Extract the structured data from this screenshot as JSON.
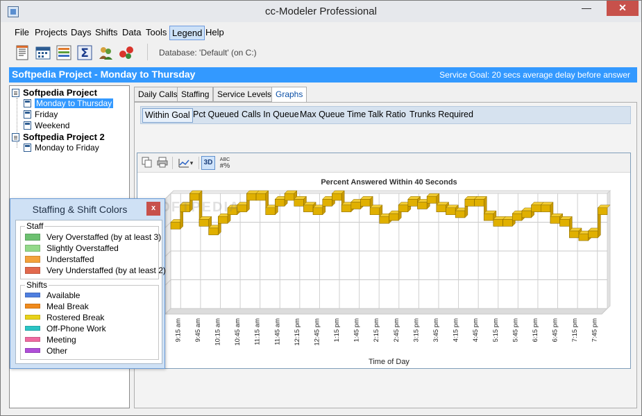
{
  "window": {
    "title": "cc-Modeler Professional",
    "minimize": "—",
    "maximize": "□",
    "close": "✕"
  },
  "menu": [
    "File",
    "Projects",
    "Days",
    "Shifts",
    "Data",
    "Tools",
    "Legend",
    "Help"
  ],
  "menu_active": "Legend",
  "toolbar": {
    "icons": [
      "notepad-icon",
      "calendar-icon",
      "chart-grid-icon",
      "sigma-icon",
      "people-icon",
      "transfer-icon"
    ],
    "database_label": "Database: 'Default' (on C:)"
  },
  "project_header": {
    "title": "Softpedia Project - Monday to Thursday",
    "service_goal": "Service Goal: 20 secs average delay before answer"
  },
  "tree": {
    "projects": [
      {
        "label": "Softpedia Project",
        "days": [
          "Monday to Thursday",
          "Friday",
          "Weekend"
        ]
      },
      {
        "label": "Softpedia Project 2",
        "days": [
          "Monday to Friday"
        ]
      }
    ],
    "selected": "Monday to Thursday"
  },
  "tabs": [
    "Daily Calls",
    "Staffing",
    "Service Levels",
    "Graphs"
  ],
  "active_tab": "Graphs",
  "subtabs": [
    "Within Goal",
    "Pct Queued",
    "Calls In Queue",
    "Max Queue Time",
    "Talk Ratio",
    "Trunks Required"
  ],
  "active_subtab": "Within Goal",
  "chart_toolbar": {
    "icons": [
      "copy-icon",
      "print-icon",
      "chart-type-icon",
      "3d-toggle-icon",
      "abc-labels-icon"
    ],
    "chart_type_caret": "▾",
    "three_d_label": "3D",
    "abc_label": "ABC"
  },
  "chart_data": {
    "type": "line",
    "title": "Percent Answered Within 40 Seconds",
    "xlabel": "Time of Day",
    "ylabel": "",
    "style": "3d-step-ribbon",
    "color": "#e0b000",
    "grid": true,
    "categories": [
      "9:15 am",
      "9:45 am",
      "10:15 am",
      "10:45 am",
      "11:15 am",
      "11:45 am",
      "12:15 pm",
      "12:45 pm",
      "1:15 pm",
      "1:45 pm",
      "2:15 pm",
      "2:45 pm",
      "3:15 pm",
      "3:45 pm",
      "4:15 pm",
      "4:45 pm",
      "5:15 pm",
      "5:45 pm",
      "6:15 pm",
      "6:45 pm",
      "7:15 pm",
      "7:45 pm"
    ],
    "values": [
      90,
      96,
      100,
      91,
      88,
      92,
      95,
      96,
      100,
      100,
      95,
      98,
      100,
      98,
      96,
      95,
      98,
      100,
      96,
      97,
      98,
      95,
      92,
      93,
      96,
      98,
      97,
      99,
      96,
      95,
      94,
      98,
      98,
      93,
      91,
      91,
      93,
      94,
      96,
      96,
      92,
      91,
      87,
      86,
      87,
      95
    ],
    "ylim": [
      60,
      100
    ],
    "legend": "none"
  },
  "legend_panel": {
    "title": "Staffing & Shift Colors",
    "close": "x",
    "staff_label": "Staff",
    "staff": [
      {
        "label": "Very Overstaffed (by at least 3)",
        "color": "#6cc070"
      },
      {
        "label": "Slightly Overstaffed",
        "color": "#93d98a"
      },
      {
        "label": "Understaffed",
        "color": "#f4a23a"
      },
      {
        "label": "Very Understaffed (by at least 2)",
        "color": "#e2694d"
      }
    ],
    "shifts_label": "Shifts",
    "shifts": [
      {
        "label": "Available",
        "color": "#4f7fe0"
      },
      {
        "label": "Meal Break",
        "color": "#f08a1c"
      },
      {
        "label": "Rostered Break",
        "color": "#e8d21a"
      },
      {
        "label": "Off-Phone Work",
        "color": "#2bc4c4"
      },
      {
        "label": "Meeting",
        "color": "#ef6aa0"
      },
      {
        "label": "Other",
        "color": "#b04fd8"
      }
    ]
  },
  "watermark": "SOFTPEDIA"
}
